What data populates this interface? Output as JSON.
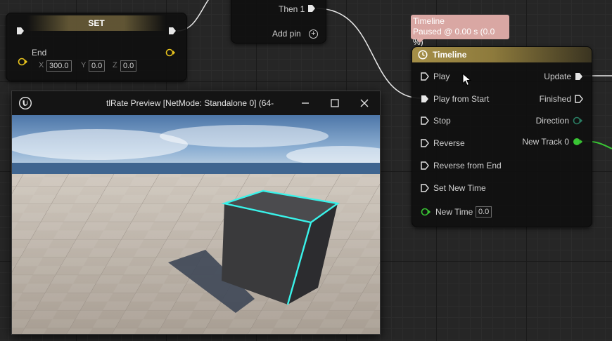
{
  "set_node": {
    "title": "SET",
    "end_label": "End",
    "x_label": "X",
    "x_value": "300.0",
    "y_label": "Y",
    "y_value": "0.0",
    "z_label": "Z",
    "z_value": "0.0"
  },
  "sequence_node": {
    "then_label": "Then 1",
    "add_pin_label": "Add pin"
  },
  "timeline_bubble": {
    "line1": "Timeline",
    "line2": "Paused @ 0.00 s (0.0 %)"
  },
  "timeline_node": {
    "title": "Timeline",
    "inputs": [
      "Play",
      "Play from Start",
      "Stop",
      "Reverse",
      "Reverse from End",
      "Set New Time"
    ],
    "new_time_label": "New Time",
    "new_time_value": "0.0",
    "outputs": [
      "Update",
      "Finished",
      "Direction",
      "New Track 0"
    ]
  },
  "preview_window": {
    "title": "tlRate Preview [NetMode: Standalone 0]  (64-"
  },
  "colors": {
    "exec_pin": "#e6e6e6",
    "vector_pin": "#e8c31d",
    "float_pin": "#39c534",
    "direction_pin": "#2a7d63",
    "comment_bubble": "#d9a7a3",
    "cube_outline": "#39f3ea"
  },
  "icons": {
    "timeline": "clock-icon",
    "add_pin": "plus-circle-icon",
    "window_minimize": "minimize-icon",
    "window_maximize": "maximize-icon",
    "window_close": "close-icon",
    "app_logo": "unreal-logo-icon"
  }
}
